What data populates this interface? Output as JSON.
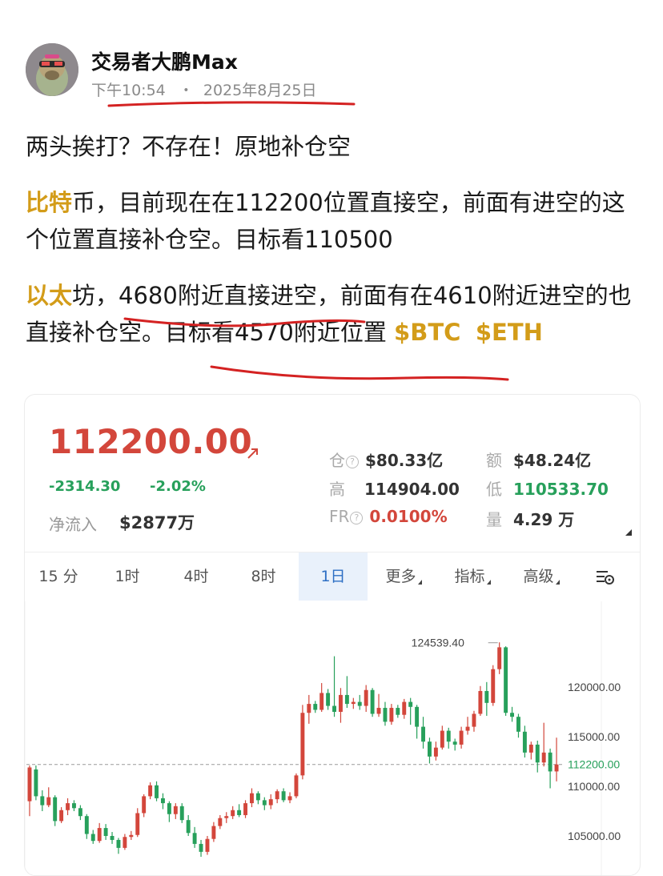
{
  "author": {
    "name": "交易者大鹏Max",
    "time": "下午10:54",
    "date": "2025年8月25日",
    "dot": "・"
  },
  "post": {
    "line1": "两头挨打？不存在！原地补仓空",
    "btc_label": "比特",
    "btc_rest": "币，目前现在在112200位置直接空，前面有进空的这个位置直接补仓空。目标看110500",
    "eth_label": "以太",
    "eth_a": "坊，",
    "eth_b": "4680附近直接进空",
    "eth_c": "，前面有在4610附近进空的也直接补仓空。",
    "eth_d": "目标看4570附近位置",
    "ticker1": "$BTC",
    "ticker2": "$ETH"
  },
  "colors": {
    "up": "#d3463b",
    "down": "#27a05b",
    "accent": "#d39c19",
    "annotation": "#d42222",
    "active_tab": "#2d6fc4"
  },
  "card": {
    "price": "112200.00",
    "change": "-2314.30",
    "change_pct": "-2.02%",
    "net_label": "净流入",
    "net_value": "$2877万",
    "stats": {
      "oi_label": "仓",
      "oi_value": "$80.33亿",
      "amt_label": "额",
      "amt_value": "$48.24亿",
      "high_label": "高",
      "high_value": "114904.00",
      "low_label": "低",
      "low_value": "110533.70",
      "fr_label": "FR",
      "fr_value": "0.0100%",
      "vol_label": "量",
      "vol_value": "4.29 万"
    },
    "tabs": [
      "15 分",
      "1时",
      "4时",
      "8时",
      "1日",
      "更多",
      "指标",
      "高级"
    ],
    "active_tab": "1日"
  },
  "chart_data": {
    "type": "candlestick",
    "y_ticks": [
      "120000.00",
      "115000.00",
      "110000.00",
      "105000.00"
    ],
    "y_tick_values": [
      120000,
      115000,
      110000,
      105000
    ],
    "current_price_label": "112200.00",
    "current_price": 112200,
    "max_label": "124539.40",
    "max_value": 124539.4,
    "candles": [
      [
        108500,
        111900,
        107000,
        112100
      ],
      [
        111700,
        109000,
        108600,
        112100
      ],
      [
        109000,
        108100,
        107500,
        109600
      ],
      [
        108100,
        108900,
        107900,
        109900
      ],
      [
        108900,
        106500,
        106000,
        109100
      ],
      [
        106500,
        107600,
        106300,
        107900
      ],
      [
        107600,
        108300,
        107100,
        108800
      ],
      [
        108300,
        107800,
        107500,
        108600
      ],
      [
        107800,
        107000,
        106600,
        108100
      ],
      [
        107000,
        105200,
        104700,
        107200
      ],
      [
        105200,
        104500,
        104200,
        105600
      ],
      [
        104500,
        105800,
        104300,
        106300
      ],
      [
        105800,
        105000,
        104600,
        106200
      ],
      [
        105000,
        104600,
        104200,
        105400
      ],
      [
        104600,
        103800,
        103200,
        104800
      ],
      [
        103800,
        104900,
        103600,
        105200
      ],
      [
        104900,
        105100,
        104600,
        105500
      ],
      [
        105100,
        107300,
        104900,
        107800
      ],
      [
        107300,
        109000,
        106900,
        109200
      ],
      [
        109000,
        110100,
        108700,
        110400
      ],
      [
        110100,
        108800,
        108500,
        110500
      ],
      [
        108800,
        108300,
        107700,
        109300
      ],
      [
        108300,
        107200,
        106400,
        108500
      ],
      [
        107200,
        108000,
        106700,
        108300
      ],
      [
        108000,
        106600,
        106300,
        108300
      ],
      [
        106600,
        105300,
        105000,
        107100
      ],
      [
        105300,
        104200,
        103800,
        105900
      ],
      [
        104200,
        103400,
        102900,
        104600
      ],
      [
        103400,
        104700,
        103100,
        105000
      ],
      [
        104700,
        106000,
        104400,
        106400
      ],
      [
        106000,
        106800,
        105700,
        107100
      ],
      [
        106800,
        107000,
        106300,
        107400
      ],
      [
        107000,
        107600,
        106700,
        108000
      ],
      [
        107600,
        107100,
        106900,
        108200
      ],
      [
        107100,
        108300,
        106800,
        108600
      ],
      [
        108300,
        109300,
        107900,
        109800
      ],
      [
        109300,
        108600,
        108200,
        109500
      ],
      [
        108600,
        108100,
        107600,
        108900
      ],
      [
        108100,
        108700,
        107700,
        109200
      ],
      [
        108700,
        109500,
        108300,
        109700
      ],
      [
        109500,
        108600,
        108400,
        109800
      ],
      [
        108600,
        109000,
        108300,
        109400
      ],
      [
        109000,
        111100,
        108800,
        111300
      ],
      [
        111100,
        117400,
        110700,
        118200
      ],
      [
        117400,
        118300,
        116300,
        119200
      ],
      [
        118300,
        117700,
        117400,
        118600
      ],
      [
        117700,
        119400,
        117500,
        120400
      ],
      [
        119400,
        118100,
        117700,
        119800
      ],
      [
        118100,
        117500,
        117000,
        123100
      ],
      [
        117500,
        119200,
        116400,
        119900
      ],
      [
        119200,
        118300,
        117900,
        121100
      ],
      [
        118300,
        118500,
        117800,
        118900
      ],
      [
        118500,
        118100,
        117700,
        119200
      ],
      [
        118100,
        119700,
        117500,
        120200
      ],
      [
        119700,
        117300,
        117000,
        119900
      ],
      [
        117300,
        117900,
        117000,
        119300
      ],
      [
        117900,
        116500,
        116100,
        118500
      ],
      [
        116500,
        117900,
        116200,
        118300
      ],
      [
        117900,
        117200,
        116900,
        118200
      ],
      [
        117200,
        118500,
        116800,
        118800
      ],
      [
        118500,
        118000,
        116200,
        118900
      ],
      [
        118000,
        116000,
        114800,
        118200
      ],
      [
        116000,
        114500,
        113800,
        117000
      ],
      [
        114500,
        113000,
        112300,
        114900
      ],
      [
        113000,
        113900,
        112600,
        114500
      ],
      [
        113900,
        115600,
        113700,
        116100
      ],
      [
        115600,
        114500,
        113800,
        115900
      ],
      [
        114500,
        114200,
        113600,
        114800
      ],
      [
        114200,
        115600,
        113800,
        116000
      ],
      [
        115600,
        116000,
        115200,
        117000
      ],
      [
        116000,
        117300,
        115500,
        117600
      ],
      [
        117300,
        119600,
        117100,
        120100
      ],
      [
        119600,
        118400,
        117100,
        120500
      ],
      [
        118400,
        121800,
        118100,
        122200
      ],
      [
        121800,
        124000,
        121300,
        124500
      ],
      [
        124000,
        117400,
        117100,
        124100
      ],
      [
        117400,
        117000,
        116500,
        118000
      ],
      [
        117000,
        115500,
        114900,
        117300
      ],
      [
        115500,
        113400,
        112900,
        116100
      ],
      [
        113400,
        114200,
        112700,
        114500
      ],
      [
        114200,
        112400,
        111400,
        114600
      ],
      [
        112400,
        113400,
        112000,
        116400
      ],
      [
        113400,
        111500,
        109800,
        113800
      ],
      [
        111500,
        112200,
        110500,
        114900
      ]
    ]
  }
}
